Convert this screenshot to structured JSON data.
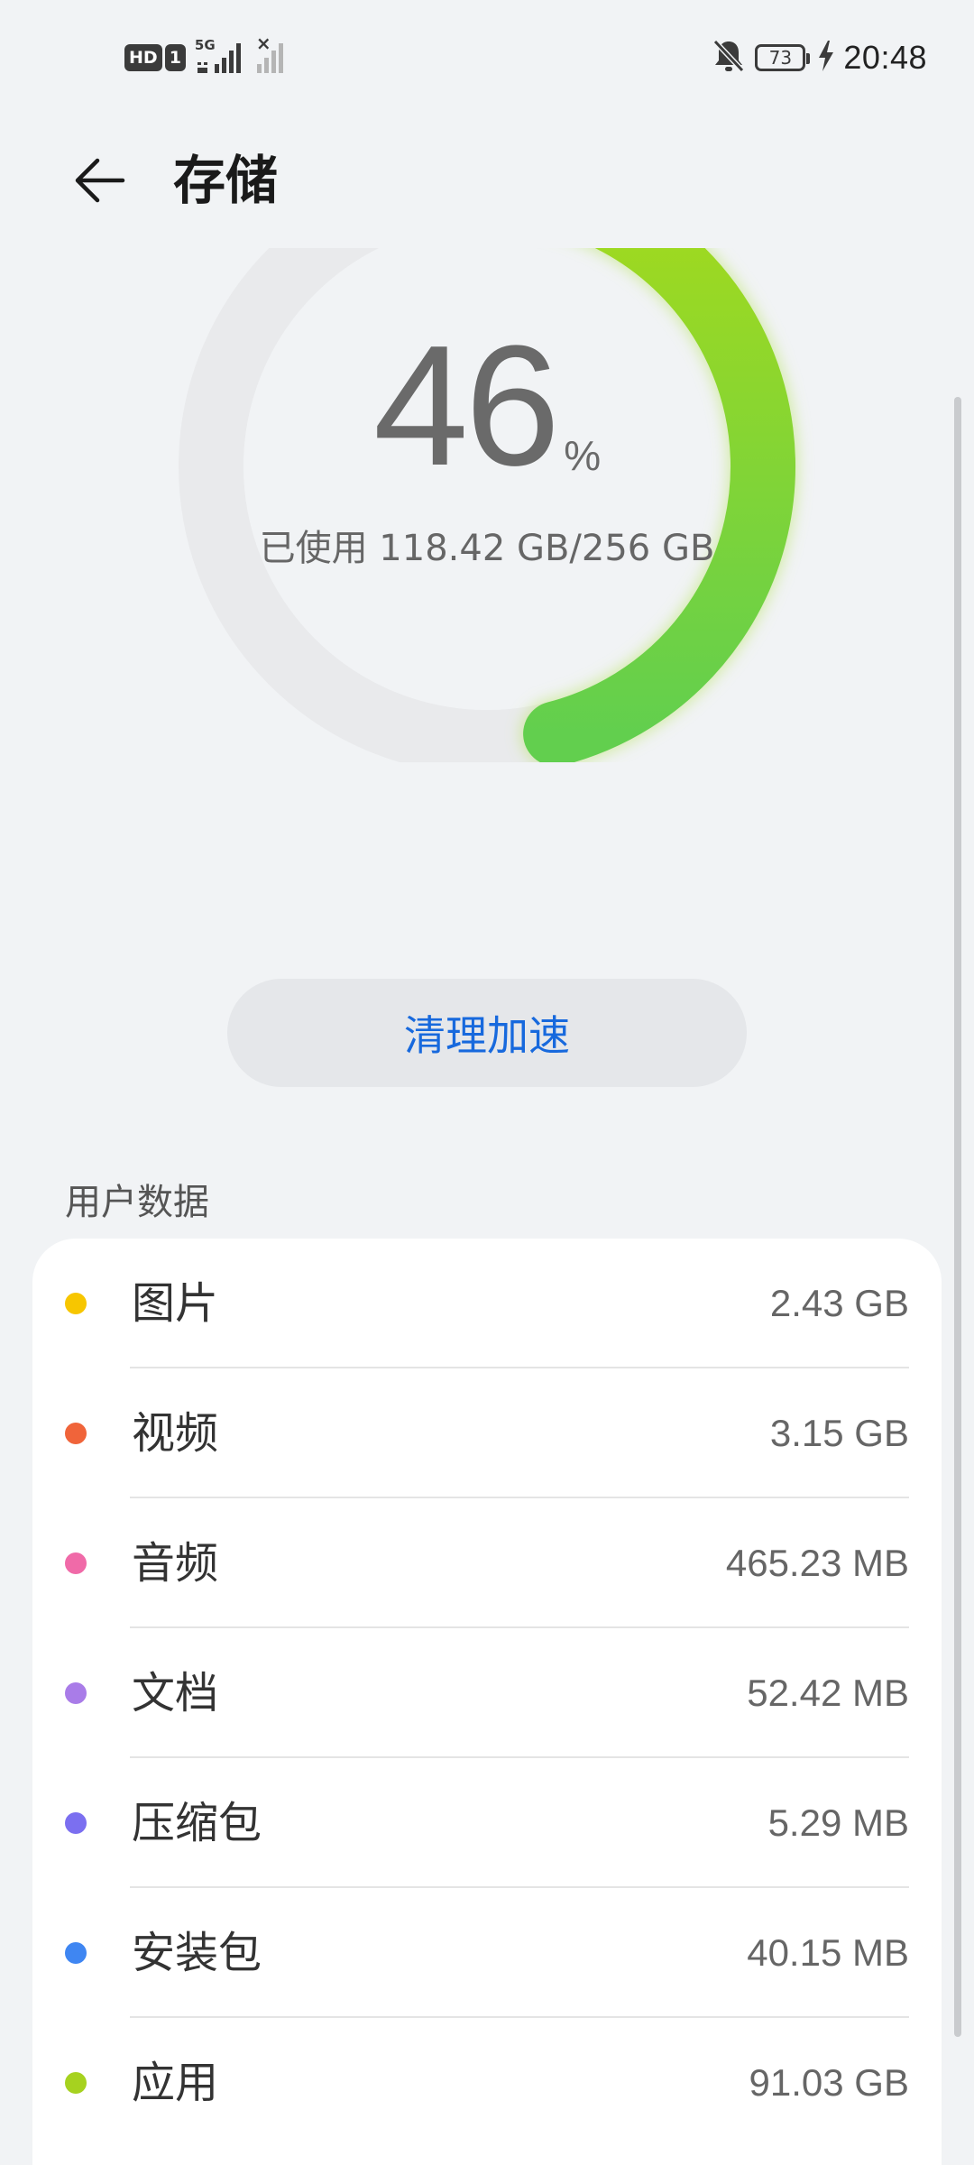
{
  "status_bar": {
    "hd_tag": "HD",
    "sim_tag": "1",
    "network_type": "5G",
    "sim2_mark": "×",
    "battery_level": "73",
    "time": "20:48",
    "icons": [
      "hd-icon",
      "signal-icon",
      "signal-no-sim-icon",
      "bell-off-icon",
      "battery-icon",
      "charging-bolt-icon"
    ]
  },
  "header": {
    "title": "存储",
    "back_icon": "arrow-left-icon"
  },
  "gauge": {
    "percent_value": "46",
    "percent_sign": "%",
    "used_text": "已使用 118.42 GB/256 GB",
    "fraction_used": 0.46,
    "colors": {
      "track": "#e9eaec",
      "arc_start": "#a4da1c",
      "arc_end": "#62cf4e"
    }
  },
  "actions": {
    "clean_label": "清理加速"
  },
  "user_data": {
    "section_title": "用户数据",
    "items": [
      {
        "label": "图片",
        "size": "2.43 GB",
        "color": "#f7c600"
      },
      {
        "label": "视频",
        "size": "3.15 GB",
        "color": "#f0643a"
      },
      {
        "label": "音频",
        "size": "465.23 MB",
        "color": "#f06aa8"
      },
      {
        "label": "文档",
        "size": "52.42 MB",
        "color": "#a97ce8"
      },
      {
        "label": "压缩包",
        "size": "5.29 MB",
        "color": "#7b6ff0"
      },
      {
        "label": "安装包",
        "size": "40.15 MB",
        "color": "#3f86f2"
      },
      {
        "label": "应用",
        "size": "91.03 GB",
        "color": "#a6d21f"
      }
    ]
  }
}
